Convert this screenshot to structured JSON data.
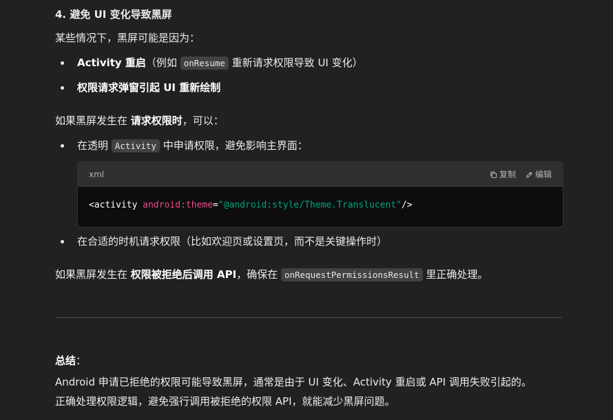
{
  "section": {
    "heading": "4. 避免 UI 变化导致黑屏",
    "intro": "某些情况下，黑屏可能是因为："
  },
  "list1": [
    {
      "bold": "Activity 重启",
      "pre": "（例如 ",
      "code": "onResume",
      "post": " 重新请求权限导致 UI 变化）"
    },
    {
      "bold": "权限请求弹窗引起 UI 重新绘制"
    }
  ],
  "para2": {
    "pre": "如果黑屏发生在 ",
    "bold": "请求权限时",
    "post": "，可以："
  },
  "list2": [
    {
      "pre": "在透明 ",
      "code": "Activity",
      "post": " 中申请权限，避免影响主界面："
    },
    {
      "text": "在合适的时机请求权限（比如欢迎页或设置页，而不是关键操作时）"
    }
  ],
  "codeblock": {
    "lang": "xml",
    "copy_label": "复制",
    "edit_label": "编辑",
    "tag_open": "<activity ",
    "attr": "android:theme",
    "eq": "=",
    "value": "\"@android:style/Theme.Translucent\"",
    "tag_close": "/>"
  },
  "para3": {
    "pre": "如果黑屏发生在 ",
    "bold": "权限被拒绝后调用 API",
    "mid": "，确保在 ",
    "code": "onRequestPermissionsResult",
    "post": " 里正确处理。"
  },
  "summary": {
    "title": "总结",
    "colon": "：",
    "line1": "Android 申请已拒绝的权限可能导致黑屏，通常是由于 UI 变化、Activity 重启或 API 调用失败引起的。",
    "line2": "正确处理权限逻辑，避免强行调用被拒绝的权限 API，就能减少黑屏问题。"
  }
}
